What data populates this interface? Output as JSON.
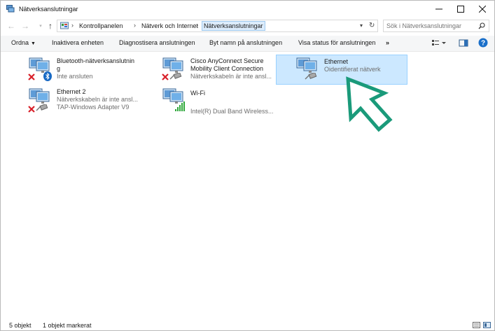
{
  "window": {
    "title": "Nätverksanslutningar"
  },
  "address": {
    "crumbs": [
      "Kontrollpanelen",
      "Nätverk och Internet",
      "Nätverksanslutningar"
    ]
  },
  "search": {
    "placeholder": "Sök i Nätverksanslutningar"
  },
  "commands": {
    "organize": "Ordna",
    "disable": "Inaktivera enheten",
    "diagnose": "Diagnostisera anslutningen",
    "rename": "Byt namn på anslutningen",
    "status": "Visa status för anslutningen",
    "more": "»"
  },
  "connections": [
    {
      "name1": "Bluetooth-nätverksanslutnin",
      "name2": "g",
      "status": "Inte ansluten",
      "device": "",
      "overlay": "bluetooth-icon",
      "disconnected": true
    },
    {
      "name1": "Cisco AnyConnect Secure",
      "name2": "Mobility Client Connection",
      "status": "Nätverkskabeln är inte ansl...",
      "device": "",
      "overlay": "cable-icon",
      "disconnected": true
    },
    {
      "name1": "Ethernet",
      "name2": "",
      "status": "Oidentifierat nätverk",
      "device": "",
      "overlay": "cable-icon",
      "disconnected": false,
      "selected": true
    },
    {
      "name1": "Ethernet 2",
      "name2": "",
      "status": "Nätverkskabeln är inte ansl...",
      "device": "TAP-Windows Adapter V9",
      "overlay": "cable-icon",
      "disconnected": true
    },
    {
      "name1": "Wi-Fi",
      "name2": "",
      "status": "",
      "device": "Intel(R) Dual Band Wireless...",
      "overlay": "signal-bars-icon",
      "disconnected": false
    }
  ],
  "statusbar": {
    "count": "5 objekt",
    "selected": "1 objekt markerat"
  },
  "colors": {
    "selection_bg": "#cce8ff",
    "selection_border": "#99d1ff",
    "accent_arrow": "#1a9a7a",
    "help_blue": "#1a6fc9"
  }
}
